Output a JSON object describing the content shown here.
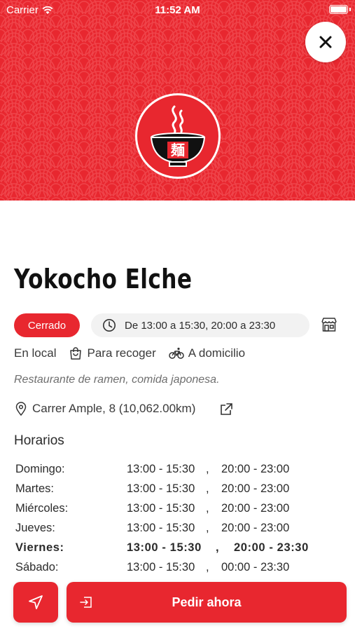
{
  "status_bar": {
    "carrier": "Carrier",
    "time": "11:52 AM"
  },
  "header": {
    "close_icon": "close-icon",
    "logo_glyph": "麺",
    "background_color": "#e8272f"
  },
  "restaurant": {
    "name": "Yokocho Elche",
    "status": "Cerrado",
    "hours_today": "De 13:00 a 15:30, 20:00 a 23:30",
    "services": [
      "En local",
      "Para recoger",
      "A domicilio"
    ],
    "description": "Restaurante de ramen, comida japonesa.",
    "address": "Carrer Ample, 8 (10,062.00km)"
  },
  "schedule": {
    "title": "Horarios",
    "rows": [
      {
        "day": "Domingo:",
        "t1": "13:00 - 15:30",
        "sep": ",",
        "t2": "20:00 - 23:00"
      },
      {
        "day": "Martes:",
        "t1": "13:00 - 15:30",
        "sep": ",",
        "t2": "20:00 - 23:00"
      },
      {
        "day": "Miércoles:",
        "t1": "13:00 - 15:30",
        "sep": ",",
        "t2": "20:00 - 23:00"
      },
      {
        "day": "Jueves:",
        "t1": "13:00 - 15:30",
        "sep": ",",
        "t2": "20:00 - 23:00"
      },
      {
        "day": "Viernes:",
        "t1": "13:00 - 15:30",
        "sep": ",",
        "t2": "20:00 - 23:30"
      },
      {
        "day": "Sábado:",
        "t1": "13:00 - 15:30",
        "sep": ",",
        "t2": "00:00 - 23:30"
      }
    ]
  },
  "actions": {
    "order_label": "Pedir ahora"
  },
  "colors": {
    "accent": "#e8272f",
    "pill_bg": "#f2f2f2"
  }
}
